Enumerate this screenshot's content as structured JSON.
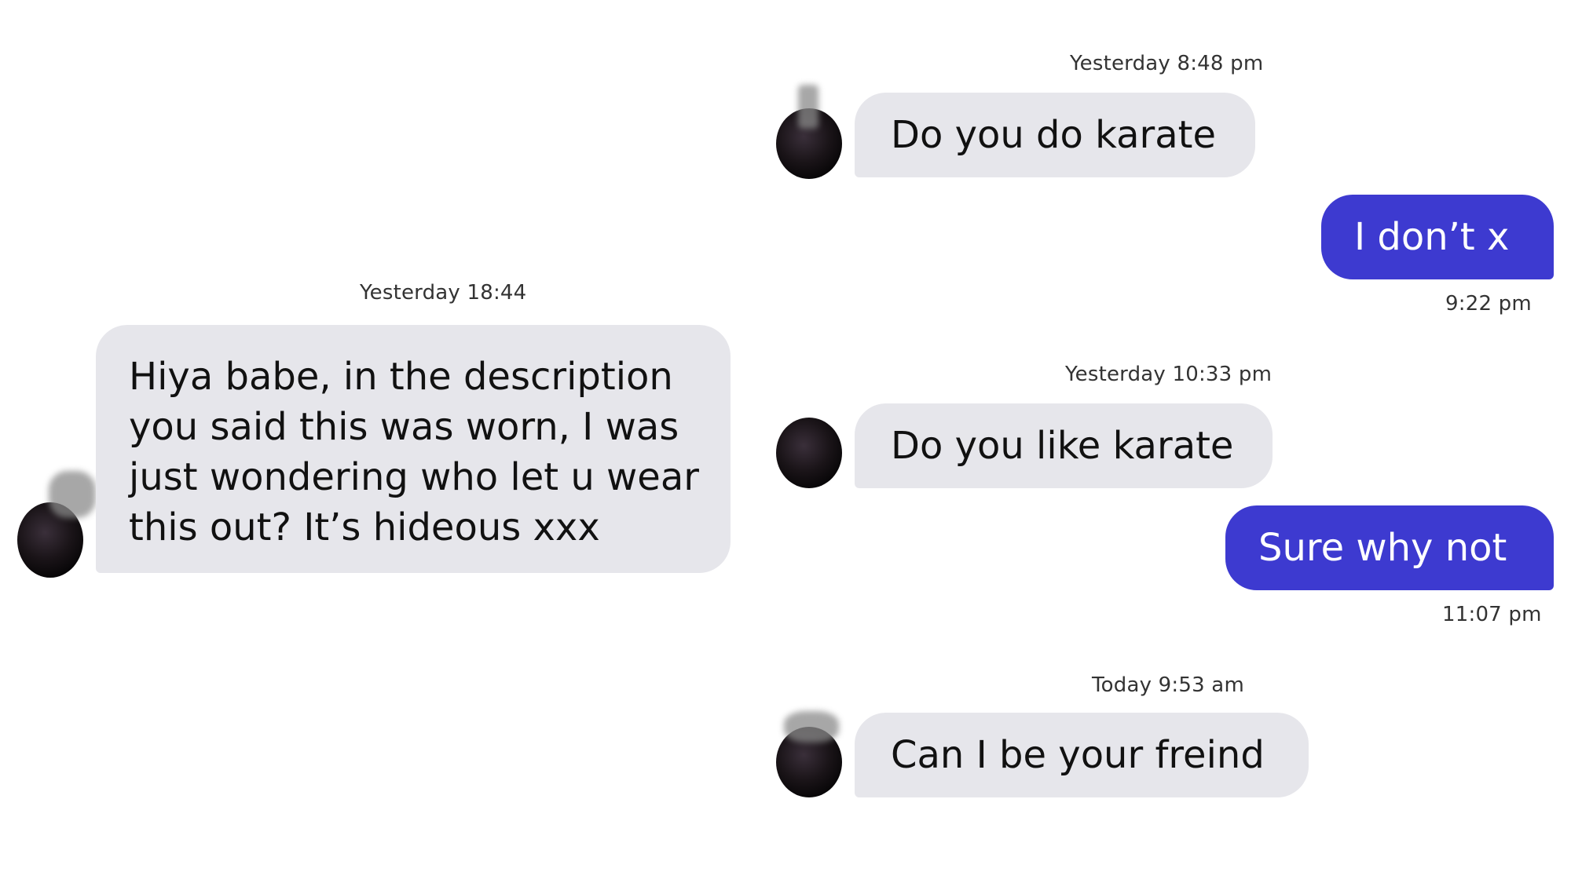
{
  "left_chat": {
    "timestamp": "Yesterday 18:44",
    "message": "Hiya babe, in the description you said this was worn, I was just wondering who let u wear this out? It’s hideous xxx"
  },
  "right_chat": {
    "messages": [
      {
        "timestamp": "Yesterday 8:48 pm",
        "text": "Do you do karate",
        "direction": "incoming"
      },
      {
        "text": "I don’t x",
        "time": "9:22 pm",
        "direction": "outgoing"
      },
      {
        "timestamp": "Yesterday 10:33 pm",
        "text": "Do you like karate",
        "direction": "incoming"
      },
      {
        "text": "Sure why not",
        "time": "11:07 pm",
        "direction": "outgoing"
      },
      {
        "timestamp": "Today 9:53 am",
        "text": "Can I be your freind",
        "direction": "incoming"
      }
    ]
  },
  "colors": {
    "incoming_bubble": "#e6e6eb",
    "outgoing_bubble": "#3d3ad0",
    "outgoing_text": "#ffffff"
  }
}
